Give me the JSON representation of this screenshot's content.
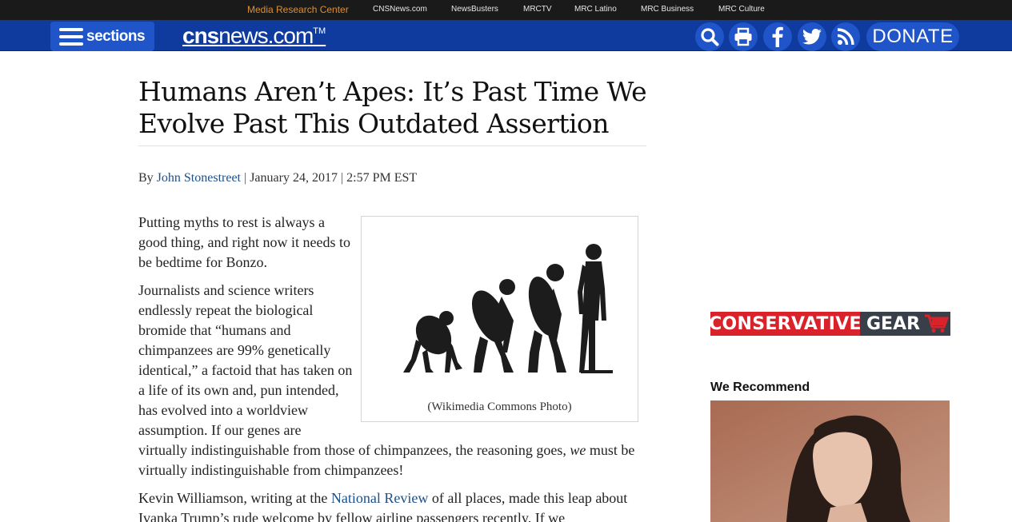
{
  "network_bar": {
    "links": [
      {
        "label": "Media Research Center",
        "highlight": true
      },
      {
        "label": "CNSNews.com"
      },
      {
        "label": "NewsBusters"
      },
      {
        "label": "MRCTV"
      },
      {
        "label": "MRC Latino"
      },
      {
        "label": "MRC Business"
      },
      {
        "label": "MRC Culture"
      }
    ]
  },
  "header": {
    "sections_label": "sections",
    "logo_bold": "cns",
    "logo_rest": "news.com",
    "logo_tm": "TM",
    "icons": [
      "search-icon",
      "print-icon",
      "facebook-icon",
      "twitter-icon",
      "rss-icon"
    ],
    "donate_label": "DONATE",
    "colors": {
      "bar": "#0f3a9e",
      "button": "#1f55c8",
      "network_bar": "#1a1a1a",
      "mrc_link": "#d8913a"
    }
  },
  "article": {
    "headline": "Humans Aren’t Apes: It’s Past Time We Evolve Past This Outdated Assertion",
    "byline": {
      "prefix": "By",
      "author": "John Stonestreet",
      "date": "January 24, 2017",
      "time": "2:57 PM EST",
      "separator": "|"
    },
    "figure": {
      "caption": "(Wikimedia Commons Photo)",
      "icon": "evolution-silhouette-image"
    },
    "paragraphs": {
      "p1": "Putting myths to rest is always a good thing, and right now it needs to be bedtime for Bonzo.",
      "p2_a": "Journalists and science writers endlessly repeat the biological bromide that “humans and chimpanzees are 99% genetically identical,” a factoid that has taken on a life of its own and, pun intended, has evolved into a worldview assumption. If our genes are virtually indistinguishable from those of chimpanzees, the reasoning goes, ",
      "p2_em": "we",
      "p2_b": " must be virtually indistinguishable from chimpanzees!",
      "p3_a": "Kevin Williamson, writing at the ",
      "p3_link": "National Review",
      "p3_b": " of all places, made this leap about Ivanka Trump’s rude welcome by fellow airline passengers recently. If we"
    }
  },
  "sidebar": {
    "banner_left": "CONSERVATIVE",
    "banner_right": "GEAR",
    "banner_colors": {
      "left": "#d9222a",
      "right": "#383f48",
      "cart": "#d9222a"
    },
    "recommend_title": "We Recommend"
  }
}
